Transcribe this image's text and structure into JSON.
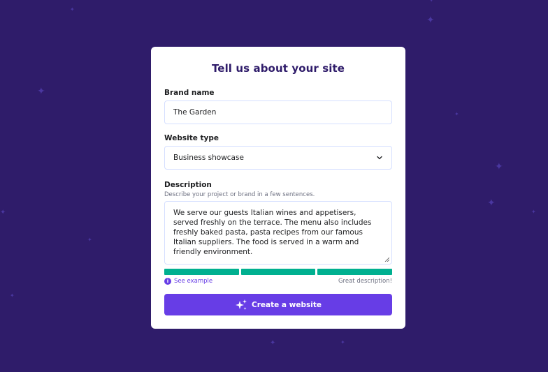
{
  "card": {
    "title": "Tell us about your site"
  },
  "brand": {
    "label": "Brand name",
    "value": "The Garden"
  },
  "website_type": {
    "label": "Website type",
    "selected": "Business showcase"
  },
  "description": {
    "label": "Description",
    "hint": "Describe your project or brand in a few sentences.",
    "value": "We serve our guests Italian wines and appetisers, served freshly on the terrace. The menu also includes freshly baked pasta, pasta recipes from our famous Italian suppliers. The food is served in a warm and friendly environment."
  },
  "quality": {
    "segments_filled": 3,
    "segments_total": 3,
    "see_example": "See example",
    "status": "Great description!"
  },
  "submit": {
    "label": "Create a website"
  },
  "colors": {
    "background": "#2f1c6a",
    "accent": "#673de6",
    "success": "#00b090"
  },
  "icons": {
    "select": "chevron-down-icon",
    "info": "info-icon",
    "button": "sparkle-icon"
  }
}
